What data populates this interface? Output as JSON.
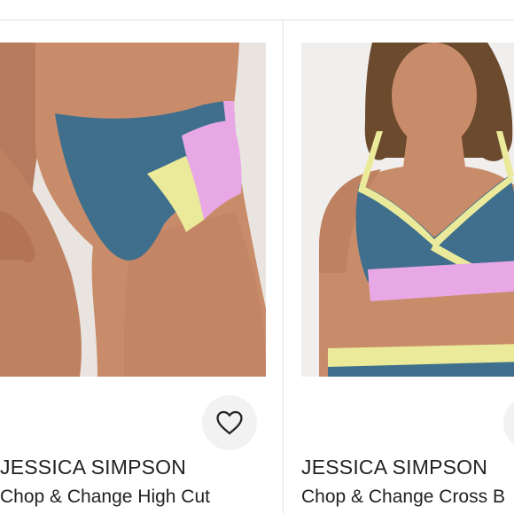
{
  "listings": [
    {
      "brand": "JESSICA SIMPSON",
      "title": "Chop & Change High Cut",
      "like_icon": "heart-outline-icon",
      "image_subject": "bikini-bottom-photo"
    },
    {
      "brand": "JESSICA SIMPSON",
      "title": "Chop & Change Cross B",
      "like_icon": "heart-outline-icon",
      "image_subject": "bikini-top-photo"
    }
  ],
  "colors": {
    "swim_teal": "#3f6f8c",
    "swim_pink": "#e8a8e6",
    "swim_yellow": "#eaea9a",
    "skin": "#c98c6a",
    "text": "#222222",
    "divider": "#e4e4e4",
    "like_button_bg": "#f2f2f2"
  }
}
